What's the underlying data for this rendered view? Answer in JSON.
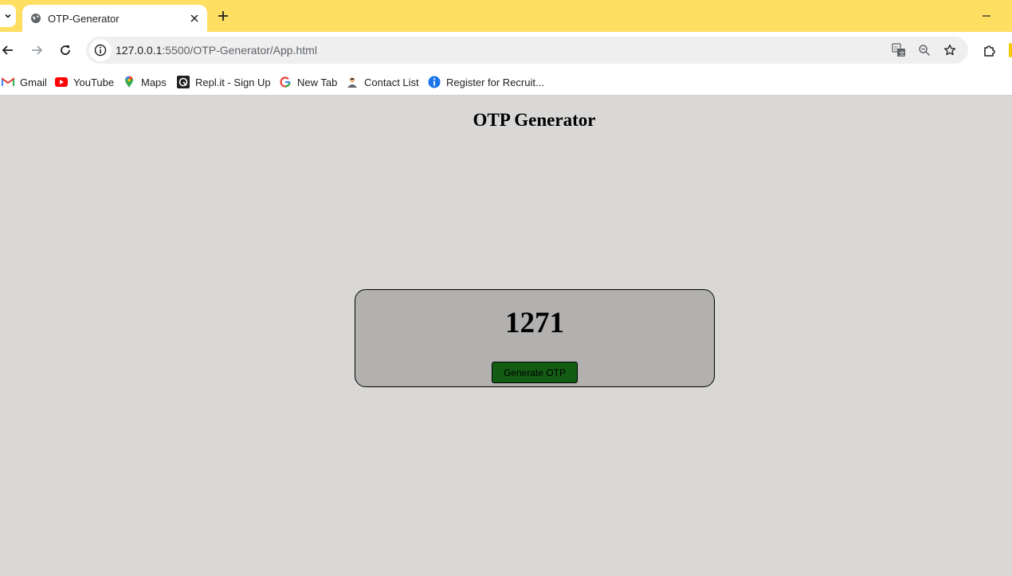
{
  "browser": {
    "tab": {
      "title": "OTP-Generator"
    },
    "address_bar": {
      "url_host": "127.0.0.1",
      "url_rest": ":5500/OTP-Generator/App.html"
    },
    "bookmarks": [
      {
        "label": "Gmail",
        "icon": "gmail-icon"
      },
      {
        "label": "YouTube",
        "icon": "youtube-icon"
      },
      {
        "label": "Maps",
        "icon": "maps-icon"
      },
      {
        "label": "Repl.it - Sign Up",
        "icon": "replit-icon"
      },
      {
        "label": "New Tab",
        "icon": "google-icon"
      },
      {
        "label": "Contact List",
        "icon": "contact-list-icon"
      },
      {
        "label": "Register for Recruit...",
        "icon": "register-icon"
      }
    ],
    "colors": {
      "frame": "#fedf62",
      "accent": "#f6c900"
    }
  },
  "page": {
    "title": "OTP Generator",
    "otp_value": "1271",
    "button_label": "Generate OTP",
    "colors": {
      "background": "#d9d8d7",
      "card": "#b2b1b0",
      "button": "#135c13"
    }
  }
}
